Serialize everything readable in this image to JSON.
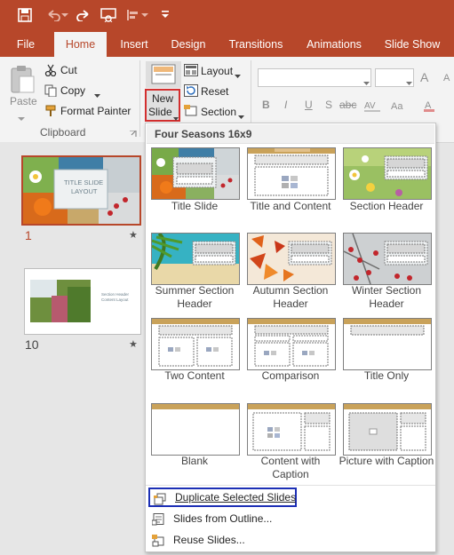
{
  "colors": {
    "accent": "#b7472a",
    "highlight_red": "#d32f2f",
    "highlight_blue": "#1c2fb5"
  },
  "quick_access": {
    "icons": [
      "save-icon",
      "undo-icon",
      "redo-icon",
      "present-icon",
      "align-icon",
      "customize-icon"
    ]
  },
  "tabs": [
    "File",
    "Home",
    "Insert",
    "Design",
    "Transitions",
    "Animations",
    "Slide Show"
  ],
  "active_tab": "Home",
  "clipboard": {
    "paste": "Paste",
    "cut": "Cut",
    "copy": "Copy",
    "format_painter": "Format Painter",
    "group_label": "Clipboard"
  },
  "slides_group": {
    "new_slide_line1": "New",
    "new_slide_line2": "Slide",
    "layout": "Layout",
    "reset": "Reset",
    "section": "Section"
  },
  "font_group": {
    "bold": "B",
    "italic": "I",
    "underline": "U",
    "strike": "S",
    "char_spacing": "abc",
    "grow": "A",
    "shrink": "A"
  },
  "slide_pane": {
    "slide1_number": "1",
    "slide1_title_line1": "TITLE SLIDE",
    "slide1_title_line2": "LAYOUT",
    "slide2_number": "10",
    "slide2_title_line1": "Section Header",
    "slide2_title_line2": "Content Layout",
    "star": "★"
  },
  "gallery": {
    "heading": "Four Seasons 16x9",
    "layouts": [
      {
        "label": "Title Slide"
      },
      {
        "label": "Title and Content"
      },
      {
        "label": "Section Header"
      },
      {
        "label": "Summer Section Header"
      },
      {
        "label": "Autumn Section Header"
      },
      {
        "label": "Winter Section Header"
      },
      {
        "label": "Two Content"
      },
      {
        "label": "Comparison"
      },
      {
        "label": "Title Only"
      },
      {
        "label": "Blank"
      },
      {
        "label": "Content with Caption"
      },
      {
        "label": "Picture with Caption"
      }
    ],
    "menu": {
      "duplicate": "Duplicate Selected Slides",
      "outline": "Slides from Outline...",
      "reuse": "Reuse Slides..."
    }
  }
}
